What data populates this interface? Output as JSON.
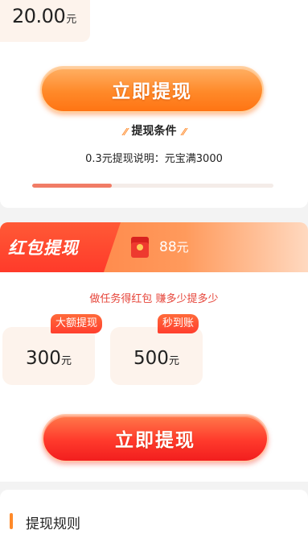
{
  "top": {
    "amount_value": "20.00",
    "amount_unit": "元",
    "withdraw_button_label": "立即提现",
    "condition_title": "提现条件",
    "condition_deco_left": "//",
    "condition_deco_right": "//",
    "condition_desc": "0.3元提现说明：元宝满3000",
    "progress_fraction": 0.33
  },
  "red_packet": {
    "title": "红包提现",
    "icon": "red-envelope-icon",
    "amount_value": "88",
    "amount_unit": "元",
    "slogan": "做任务得红包 赚多少提多少",
    "options": [
      {
        "badge": "大额提现",
        "value": "300",
        "unit": "元"
      },
      {
        "badge": "秒到账",
        "value": "500",
        "unit": "元"
      }
    ],
    "withdraw_button_label": "立即提现"
  },
  "rules": {
    "title": "提现规则"
  },
  "colors": {
    "orange_accent": "#ff8a2a",
    "red_accent": "#ff3a2a",
    "tile_bg": "#fdf3ec",
    "progress_fill": "#f17c66"
  }
}
